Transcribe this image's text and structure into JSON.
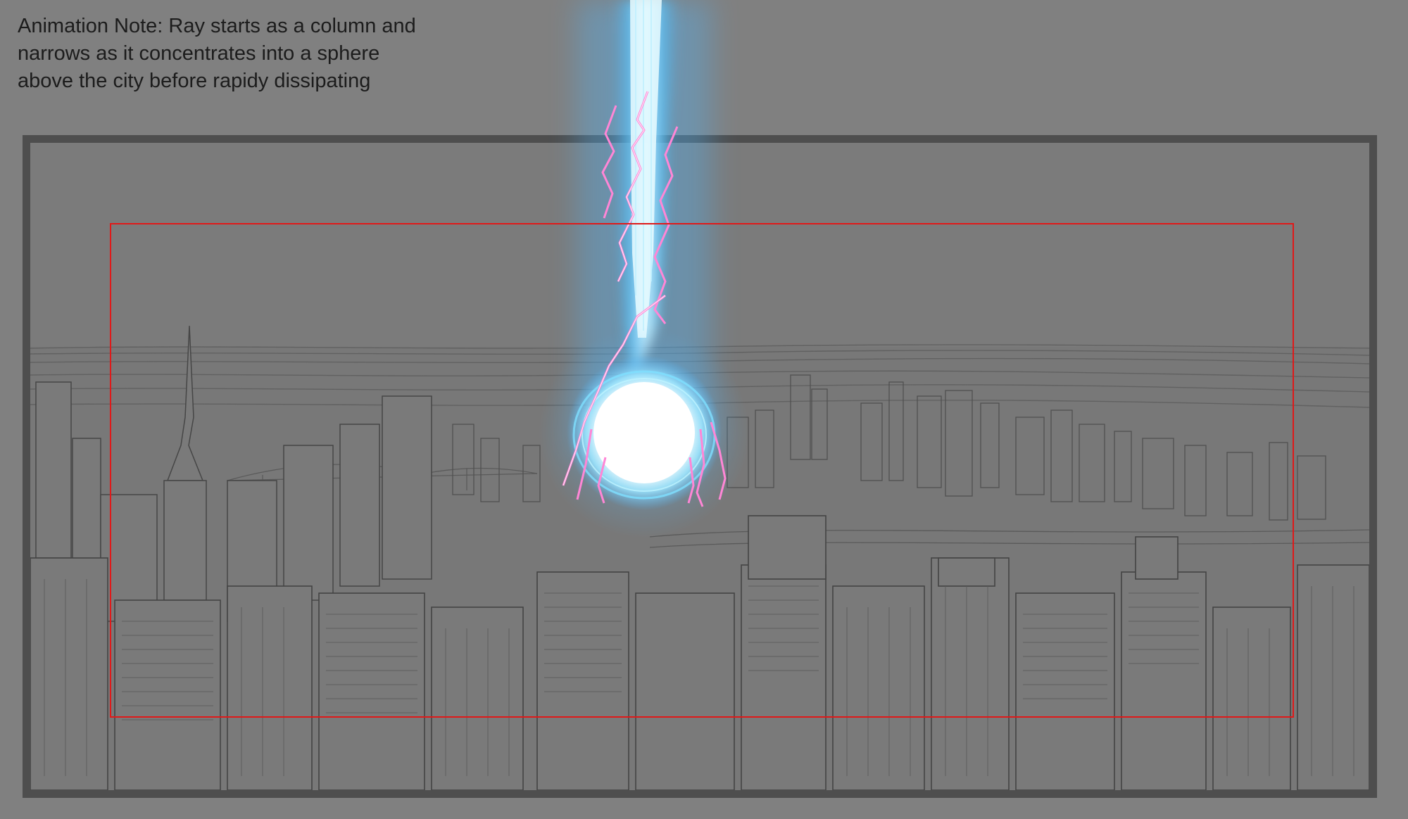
{
  "note": {
    "lines": [
      "Animation Note: Ray starts as a column and",
      "narrows as it concentrates into a sphere",
      "above the city before rapidy dissipating"
    ]
  },
  "colors": {
    "background": "#808080",
    "frame_border": "#4e4e4e",
    "safe_area_border": "#e01919",
    "beam_core": "#ffffff",
    "beam_glow": "#4fb8ff",
    "lightning": "#ff7fd0",
    "sketch_lines": "#4a4a4a"
  },
  "elements": {
    "storyboard_frame": "city-skyline-sketch",
    "energy_effect": "energy-beam-with-sphere"
  }
}
